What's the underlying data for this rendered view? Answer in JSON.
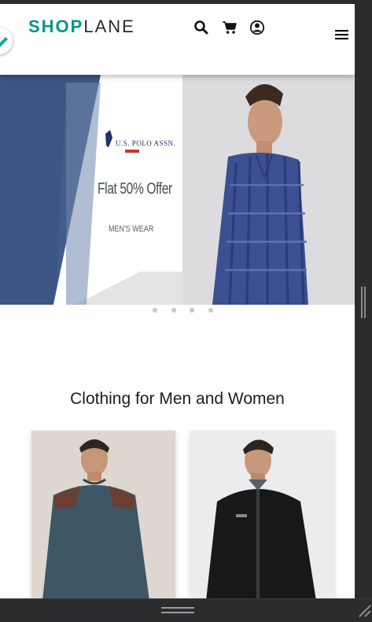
{
  "header": {
    "logo_primary": "SHOP",
    "logo_secondary": "LANE",
    "icons": [
      "search-icon",
      "cart-icon",
      "user-icon",
      "menu-icon"
    ]
  },
  "banner": {
    "brand": "U.S. POLO ASSN.",
    "offer": "Flat 50% Offer",
    "category": "MEN'S WEAR",
    "slide_count": 4,
    "active_slide": 1
  },
  "section": {
    "title": "Clothing for Men and Women"
  },
  "products": [
    {
      "image": "man-in-blue-sweatshirt"
    },
    {
      "image": "man-in-black-jacket"
    }
  ],
  "colors": {
    "brand_accent": "#009688",
    "banner_navy": "#3d5584",
    "text_dark": "#1d1d1d"
  }
}
